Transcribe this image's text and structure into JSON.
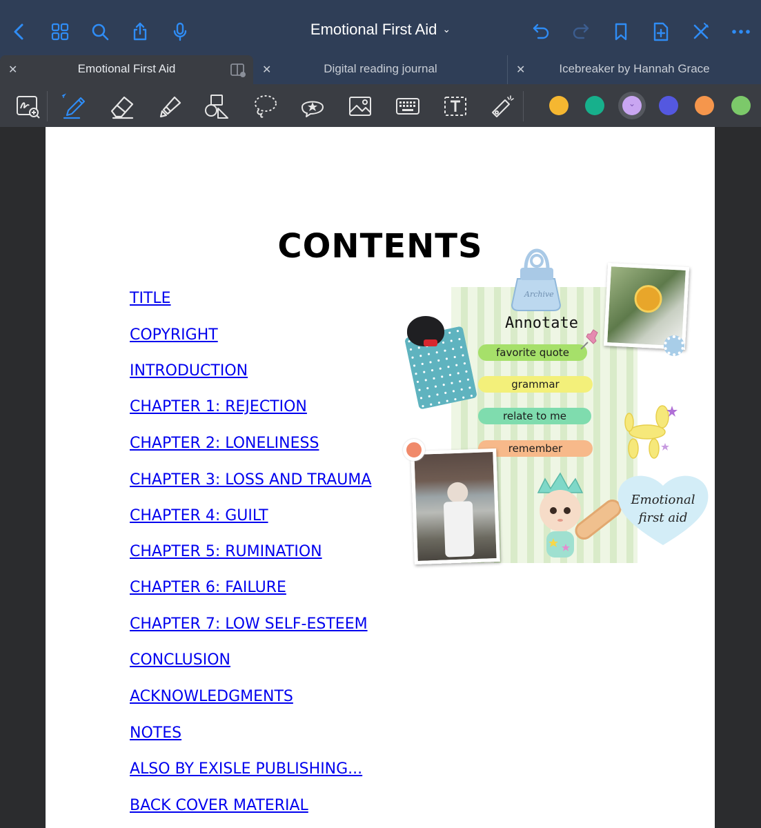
{
  "navbar": {
    "title": "Emotional First Aid",
    "icons": [
      "back-icon",
      "grid-icon",
      "search-icon",
      "share-icon",
      "mic-icon",
      "undo-icon",
      "redo-icon",
      "bookmark-icon",
      "add-page-icon",
      "close-edit-icon",
      "more-icon"
    ]
  },
  "tabs": [
    {
      "label": "Emotional First Aid",
      "active": true
    },
    {
      "label": "Digital reading journal",
      "active": false
    },
    {
      "label": "Icebreaker by Hannah Grace",
      "active": false
    }
  ],
  "tools": {
    "icons": [
      "zoom-window-icon",
      "pen-icon",
      "eraser-icon",
      "highlighter-icon",
      "shapes-icon",
      "lasso-icon",
      "elements-icon",
      "image-icon",
      "keyboard-icon",
      "text-box-icon",
      "laser-pointer-icon"
    ],
    "swatches": [
      "#f5b731",
      "#17b08c",
      "#c9a6f2",
      "#5458e0",
      "#f5964c",
      "#7cc96a"
    ],
    "selected_swatch": "#c9a6f2"
  },
  "page": {
    "heading": "CONTENTS",
    "toc": [
      "TITLE",
      "COPYRIGHT",
      "INTRODUCTION",
      "CHAPTER 1: REJECTION",
      "CHAPTER 2: LONELINESS",
      "CHAPTER 3: LOSS AND TRAUMA",
      "CHAPTER 4: GUILT",
      "CHAPTER 5: RUMINATION",
      "CHAPTER 6: FAILURE",
      "CHAPTER 7: LOW SELF-ESTEEM",
      "CONCLUSION",
      "ACKNOWLEDGMENTS",
      "NOTES",
      "ALSO BY EXISLE PUBLISHING...",
      "BACK COVER MATERIAL"
    ]
  },
  "sticker": {
    "clip_label": "Archive",
    "title": "Annotate",
    "pills": [
      {
        "label": "favorite quote",
        "color": "#a6e06a"
      },
      {
        "label": "grammar",
        "color": "#f3f07a"
      },
      {
        "label": "relate to me",
        "color": "#7fdcae"
      },
      {
        "label": "remember",
        "color": "#f7b98a"
      }
    ],
    "heart_line1": "Emotional",
    "heart_line2": "first aid"
  }
}
